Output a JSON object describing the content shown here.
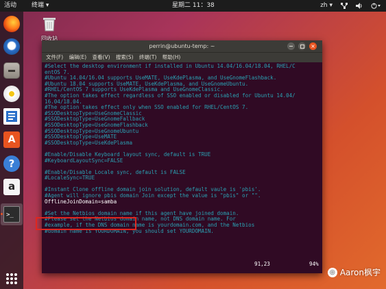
{
  "topbar": {
    "activities": "活动",
    "app_menu": "终端 ▾",
    "clock": "星期二 11：38",
    "lang": "zh ▾",
    "network_icon": "network-icon",
    "volume_icon": "volume-icon",
    "power_icon": "power-icon"
  },
  "desktop": {
    "trash_label": "回收站"
  },
  "dock": {
    "items": [
      "firefox-icon",
      "thunderbird-icon",
      "files-icon",
      "rhythmbox-icon",
      "libreoffice-writer-icon",
      "software-center-icon",
      "help-icon",
      "amazon-icon",
      "terminal-icon",
      "show-apps-icon"
    ]
  },
  "terminal": {
    "title": "perrin@ubuntu-temp: ~",
    "menu": [
      "文件(F)",
      "编辑(E)",
      "查看(V)",
      "搜索(S)",
      "终端(T)",
      "帮助(H)"
    ],
    "lines": [
      {
        "text": "#Select the desktop environment if installed in Ubuntu 14.04/16.04/18.04, RHEL/C",
        "style": "comment"
      },
      {
        "text": "entOS 7.",
        "style": "comment"
      },
      {
        "text": "#Ubuntu 14.04/16.04 supports UseMATE, UseKdePlasma, and UseGnomeFlashback.",
        "style": "comment"
      },
      {
        "text": "#Ubuntu 18.04 supports UseMATE, UseKdePlasma, and UseGnomeUbuntu.",
        "style": "comment"
      },
      {
        "text": "#RHEL/CentOS 7 supports UseKdePlasma and UseGnomeClassic.",
        "style": "comment"
      },
      {
        "text": "#The option takes effect regardless of SSO enabled or disabled for Ubuntu 14.04/",
        "style": "comment"
      },
      {
        "text": "16.04/18.04.",
        "style": "comment"
      },
      {
        "text": "#The option takes effect only when SSO enabled for RHEL/CentOS 7.",
        "style": "comment"
      },
      {
        "text": "#SSODesktopType=UseGnomeClassic",
        "style": "comment"
      },
      {
        "text": "#SSODesktopType=UseGnomeFallback",
        "style": "comment"
      },
      {
        "text": "#SSODesktopType=UseGnomeFlashback",
        "style": "comment"
      },
      {
        "text": "#SSODesktopType=UseGnomeUbuntu",
        "style": "comment"
      },
      {
        "text": "#SSODesktopType=UseMATE",
        "style": "comment"
      },
      {
        "text": "#SSODesktopType=UseKdePlasma",
        "style": "comment"
      },
      {
        "text": "",
        "style": "comment"
      },
      {
        "text": "#Enable/Disable Keyboard layout sync, default is TRUE",
        "style": "comment"
      },
      {
        "text": "#KeyboardLayoutSync=FALSE",
        "style": "comment"
      },
      {
        "text": "",
        "style": "comment"
      },
      {
        "text": "#Enable/Disable Locale sync, default is FALSE",
        "style": "comment"
      },
      {
        "text": "#LocaleSync=TRUE",
        "style": "comment"
      },
      {
        "text": "",
        "style": "comment"
      },
      {
        "text": "#Instant Clone offline domain join solution, default vaule is 'pbis'.",
        "style": "comment"
      },
      {
        "text": "#Agent will ignore pbis domain Join except the value is \"pbis\" or \"\".",
        "style": "comment"
      },
      {
        "text": "OfflineJoinDomain=samba",
        "style": "plain"
      },
      {
        "text": "",
        "style": "comment"
      },
      {
        "text": "#Set the Netbios domain name if this agent have joined domain.",
        "style": "comment"
      },
      {
        "text": "#Please set the Netbios domain name, not DNS domain name. For",
        "style": "comment"
      },
      {
        "text": "#example, if the DNS domain name is yourdomain.com, and the Netbios",
        "style": "comment"
      },
      {
        "text": "#domain name is YOURDOMAIN, you should set YOURDOMAIN.",
        "style": "comment"
      }
    ],
    "status_position": "91,23",
    "status_percent": "94%"
  },
  "watermark": {
    "text": "Aaron枫宇"
  },
  "colors": {
    "comment": "#2aa1b3",
    "plain": "#ffffff",
    "highlight_box": "#e0261f",
    "terminal_bg": "#300a24"
  }
}
